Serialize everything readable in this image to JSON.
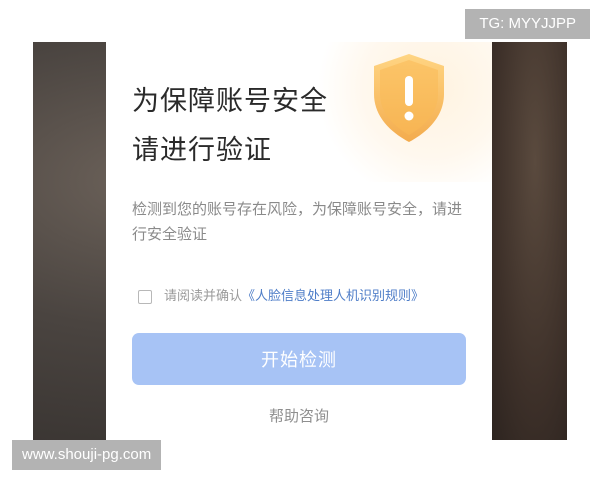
{
  "dialog": {
    "title_line1": "为保障账号安全",
    "title_line2": "请进行验证",
    "description": "检测到您的账号存在风险，为保障账号安全，请进行安全验证",
    "consent": {
      "prefix": "请阅读并确认",
      "link": "《人脸信息处理人机识别规则》",
      "checked": false
    },
    "start_button": "开始检测",
    "help_link": "帮助咨询",
    "icon": "shield-exclamation-icon"
  },
  "watermarks": {
    "top": "TG: MYYJJPP",
    "bottom": "www.shouji-pg.com"
  },
  "colors": {
    "primary_button": "#a7c3f5",
    "link": "#4f7ec8",
    "shield": "#f6b04a"
  }
}
